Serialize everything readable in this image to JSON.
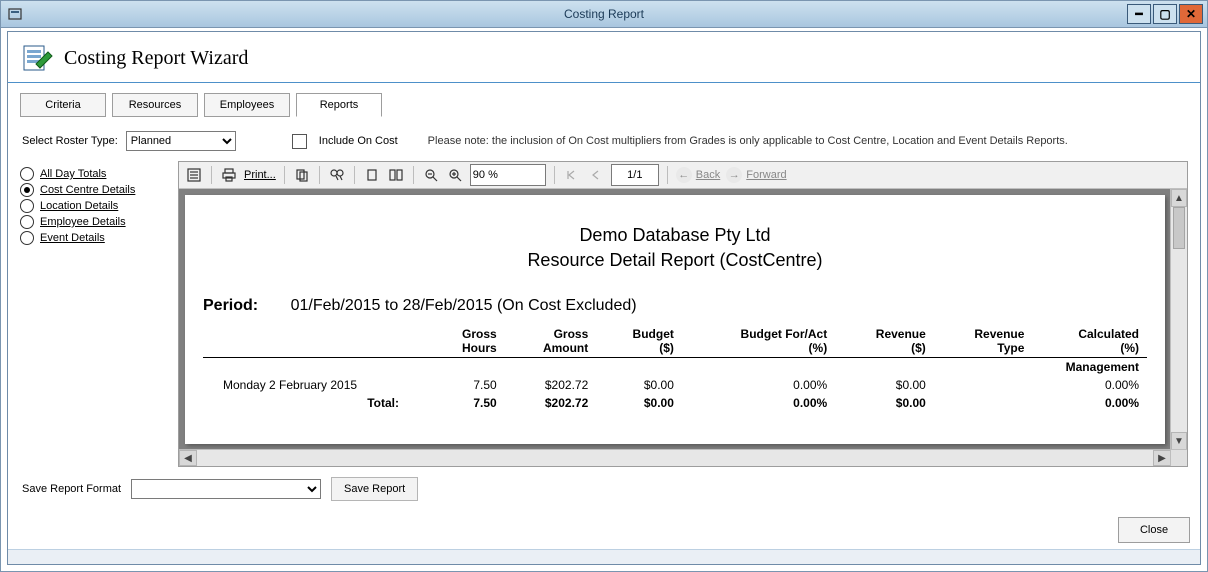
{
  "window": {
    "title": "Costing Report"
  },
  "header": {
    "title": "Costing Report Wizard"
  },
  "tabs": [
    "Criteria",
    "Resources",
    "Employees",
    "Reports"
  ],
  "active_tab": 3,
  "roster": {
    "label": "Select Roster Type:",
    "value": "Planned",
    "include_on_cost_label": "Include On Cost",
    "include_on_cost_checked": false,
    "note": "Please note: the inclusion of On Cost multipliers from Grades is only applicable to Cost Centre, Location and Event Details Reports."
  },
  "options": [
    {
      "label": "All Day Totals",
      "selected": false
    },
    {
      "label": "Cost Centre Details",
      "selected": true
    },
    {
      "label": "Location Details",
      "selected": false
    },
    {
      "label": "Employee Details",
      "selected": false
    },
    {
      "label": "Event Details",
      "selected": false
    }
  ],
  "toolbar": {
    "print_label": "Print...",
    "zoom": "90 %",
    "page": "1/1",
    "back_label": "Back",
    "forward_label": "Forward"
  },
  "report": {
    "company": "Demo Database Pty Ltd",
    "title": "Resource Detail Report (CostCentre)",
    "period_label": "Period:",
    "period_text": "01/Feb/2015 to 28/Feb/2015 (On Cost Excluded)",
    "columns": [
      "Gross Hours",
      "Gross Amount",
      "Budget ($)",
      "Budget For/Act (%)",
      "Revenue ($)",
      "Revenue Type",
      "Calculated (%)"
    ],
    "group": "Management",
    "row_label": "Monday 2 February 2015",
    "row": [
      "7.50",
      "$202.72",
      "$0.00",
      "0.00%",
      "$0.00",
      "",
      "0.00%"
    ],
    "total_label": "Total:",
    "total": [
      "7.50",
      "$202.72",
      "$0.00",
      "0.00%",
      "$0.00",
      "",
      "0.00%"
    ]
  },
  "save": {
    "format_label": "Save Report Format",
    "save_label": "Save Report"
  },
  "footer": {
    "close_label": "Close"
  }
}
